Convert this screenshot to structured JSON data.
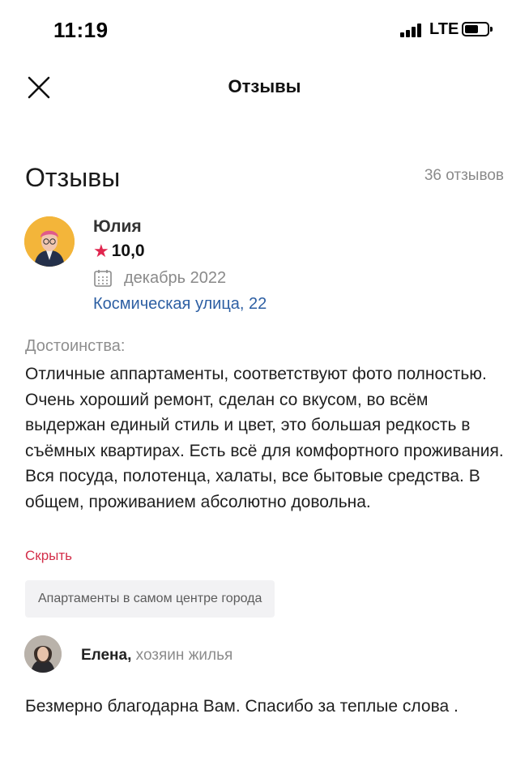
{
  "status_bar": {
    "time": "11:19",
    "network": "LTE"
  },
  "nav": {
    "title": "Отзывы",
    "close_icon": "close-icon"
  },
  "section": {
    "title": "Отзывы",
    "count": "36 отзывов"
  },
  "review": {
    "author": "Юлия",
    "rating": "10,0",
    "date": "декабрь 2022",
    "address": "Космическая улица, 22",
    "pros_label": "Достоинства:",
    "text": "Отличные аппартаменты, соответствуют фото полностью. Очень хороший ремонт, сделан со вкусом, во всём выдержан единый стиль и цвет, это большая редкость в съёмных квартирах. Есть всё для комфортного проживания. Вся посуда, полотенца, халаты, все бытовые средства. В общем, проживанием абсолютно довольна.",
    "hide_label": "Скрыть",
    "tag": "Апартаменты в самом центре города"
  },
  "owner_reply": {
    "name": "Елена,",
    "role": "хозяин жилья",
    "text": "Безмерно благодарна Вам. Спасибо за теплые слова ."
  },
  "colors": {
    "star": "#e0254e",
    "link": "#2d5fa3",
    "hide": "#d32f4a",
    "avatar_bg": "#f3b53a"
  },
  "icons": [
    "close-icon",
    "star-icon",
    "calendar-icon",
    "signal-icon",
    "battery-icon"
  ]
}
